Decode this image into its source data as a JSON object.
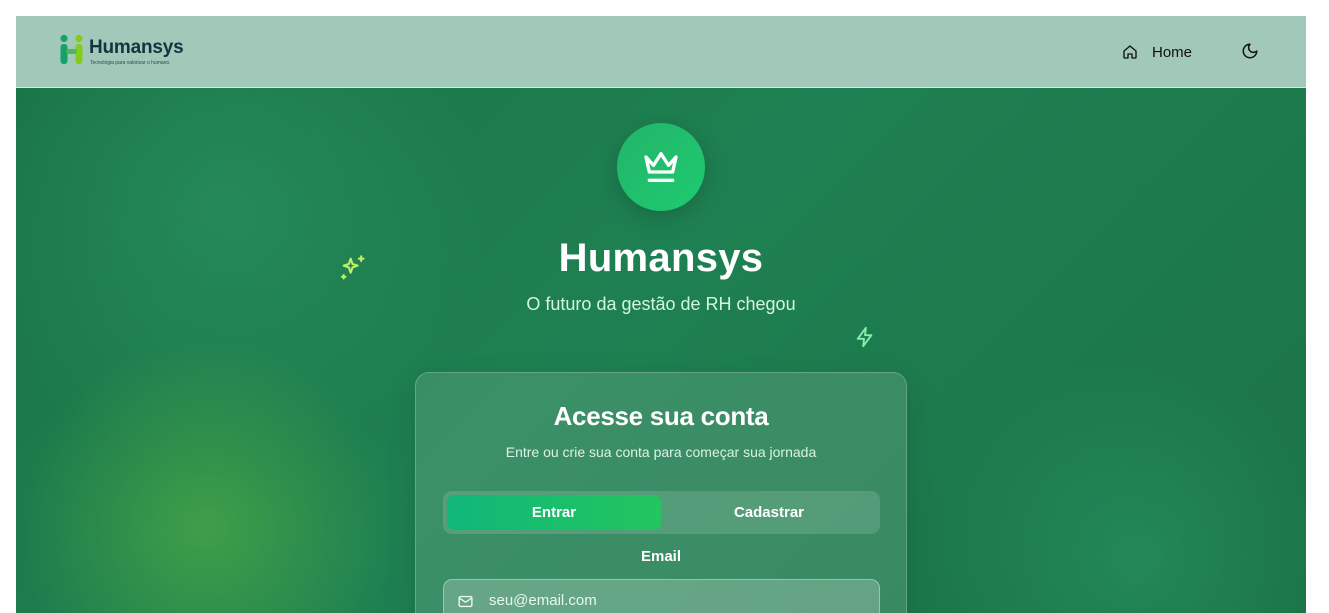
{
  "header": {
    "logo_name": "Humansys",
    "logo_tagline": "Tecnologia para valorizar o humano.",
    "nav_home_label": "Home",
    "icons": {
      "home": "home-icon",
      "theme": "moon-icon"
    }
  },
  "hero": {
    "title": "Humansys",
    "subtitle": "O futuro da gestão de RH chegou",
    "icons": {
      "badge": "crown-icon",
      "left_decor": "sparkles-icon",
      "right_decor": "zap-icon"
    }
  },
  "login_card": {
    "title": "Acesse sua conta",
    "subtitle": "Entre ou crie sua conta para começar sua jornada",
    "tabs": [
      {
        "label": "Entrar",
        "active": true
      },
      {
        "label": "Cadastrar",
        "active": false
      }
    ],
    "email_label": "Email",
    "email_placeholder": "seu@email.com",
    "email_value": "",
    "email_icon": "mail-icon"
  },
  "colors": {
    "header_bg": "#a2c8b9",
    "hero_green": "#1e8052",
    "accent": "#22c55e",
    "sparkle": "#bef264",
    "bolt": "#86efac"
  }
}
